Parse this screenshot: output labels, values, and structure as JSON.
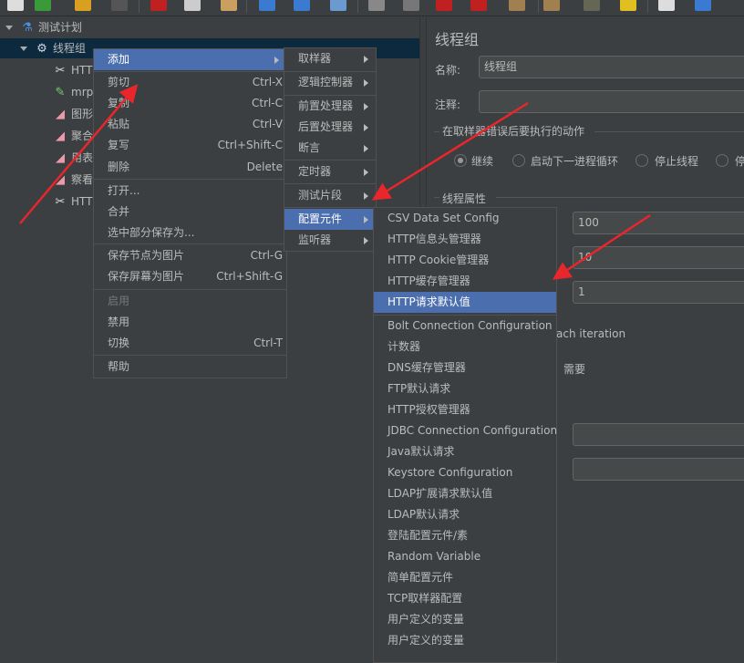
{
  "toolbar": {
    "icons": [
      "new-icon",
      "templates-icon",
      "open-icon",
      "save-icon",
      "cut-icon",
      "copy-icon",
      "paste-icon",
      "expand-icon",
      "collapse-icon",
      "toggle-icon",
      "start-icon",
      "start-no-pause-icon",
      "stop-icon",
      "shutdown-icon",
      "clear-icon",
      "clear-all-icon",
      "search-icon",
      "reset-search-icon",
      "function-helper-icon",
      "help-icon"
    ]
  },
  "tree": {
    "root": "测试计划",
    "thread_group": "线程组",
    "children": [
      "HTT",
      "mrp",
      "图形",
      "聚合",
      "用表",
      "察看",
      "HTT"
    ]
  },
  "context_menu": {
    "items": [
      {
        "label": "添加",
        "shortcut": "",
        "submenu": true,
        "highlighted": true
      },
      {
        "label": "剪切",
        "shortcut": "Ctrl-X"
      },
      {
        "label": "复制",
        "shortcut": "Ctrl-C"
      },
      {
        "label": "粘贴",
        "shortcut": "Ctrl-V"
      },
      {
        "label": "复写",
        "shortcut": "Ctrl+Shift-C"
      },
      {
        "label": "删除",
        "shortcut": "Delete"
      },
      {
        "label": "打开...",
        "shortcut": ""
      },
      {
        "label": "合并",
        "shortcut": ""
      },
      {
        "label": "选中部分保存为...",
        "shortcut": ""
      },
      {
        "label": "保存节点为图片",
        "shortcut": "Ctrl-G"
      },
      {
        "label": "保存屏幕为图片",
        "shortcut": "Ctrl+Shift-G"
      },
      {
        "label": "启用",
        "shortcut": "",
        "disabled": true
      },
      {
        "label": "禁用",
        "shortcut": ""
      },
      {
        "label": "切换",
        "shortcut": "Ctrl-T"
      },
      {
        "label": "帮助",
        "shortcut": ""
      }
    ]
  },
  "add_submenu": {
    "items": [
      "取样器",
      "逻辑控制器",
      "前置处理器",
      "后置处理器",
      "断言",
      "定时器",
      "测试片段",
      "配置元件",
      "监听器"
    ],
    "highlighted": "配置元件"
  },
  "config_submenu": {
    "items": [
      "CSV Data Set Config",
      "HTTP信息头管理器",
      "HTTP Cookie管理器",
      "HTTP缓存管理器",
      "HTTP请求默认值",
      "Bolt Connection Configuration",
      "计数器",
      "DNS缓存管理器",
      "FTP默认请求",
      "HTTP授权管理器",
      "JDBC Connection Configuration",
      "Java默认请求",
      "Keystore Configuration",
      "LDAP扩展请求默认值",
      "LDAP默认请求",
      "登陆配置元件/素",
      "Random Variable",
      "简单配置元件",
      "TCP取样器配置",
      "用户定义的变量",
      "用户定义的变量"
    ],
    "highlighted": "HTTP请求默认值"
  },
  "panel": {
    "title": "线程组",
    "name_label": "名称:",
    "name_value": "线程组",
    "comment_label": "注释:",
    "comment_value": "",
    "error_action_legend": "在取样器错误后要执行的动作",
    "radios": [
      {
        "label": "继续",
        "selected": true
      },
      {
        "label": "启动下一进程循环"
      },
      {
        "label": "停止线程"
      },
      {
        "label": "停"
      }
    ],
    "thread_props_legend": "线程属性",
    "threads_value": "100",
    "rampup_value": "10",
    "loop_value": "1",
    "same_user_text": "ach iteration",
    "delay_text": "需要"
  },
  "colors": {
    "background": "#3c3f41",
    "highlight": "#4b6eaf",
    "tree_selection": "#0d293e",
    "annotation_arrow": "#e8262b"
  }
}
